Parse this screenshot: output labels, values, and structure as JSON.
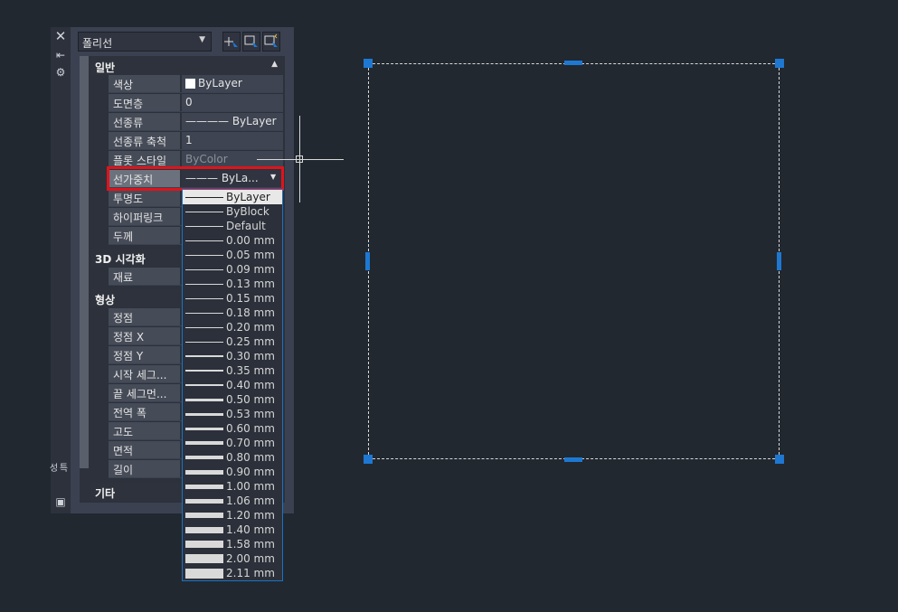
{
  "palette": {
    "object_type": "폴리선",
    "categories": {
      "general": "일반",
      "visualization3d": "3D 시각화",
      "geometry": "형상",
      "misc": "기타"
    },
    "general_rows": [
      {
        "label": "색상",
        "value": "ByLayer"
      },
      {
        "label": "도면층",
        "value": "0"
      },
      {
        "label": "선종류",
        "value": "———— ByLayer"
      },
      {
        "label": "선종류 축척",
        "value": "1"
      },
      {
        "label": "플롯 스타일",
        "value": "ByColor"
      },
      {
        "label": "선가중치",
        "value": "——— ByLa..."
      },
      {
        "label": "투명도",
        "value": ""
      },
      {
        "label": "하이퍼링크",
        "value": ""
      },
      {
        "label": "두께",
        "value": ""
      }
    ],
    "visual_rows": [
      {
        "label": "재료",
        "value": ""
      }
    ],
    "geometry_rows": [
      {
        "label": "정점",
        "value": ""
      },
      {
        "label": "정점 X",
        "value": ""
      },
      {
        "label": "정점 Y",
        "value": ""
      },
      {
        "label": "시작 세그...",
        "value": ""
      },
      {
        "label": "끝 세그먼...",
        "value": ""
      },
      {
        "label": "전역 폭",
        "value": ""
      },
      {
        "label": "고도",
        "value": ""
      },
      {
        "label": "면적",
        "value": ""
      },
      {
        "label": "길이",
        "value": ""
      }
    ],
    "side_label": "특성"
  },
  "lineweight_options": [
    "ByLayer",
    "ByBlock",
    "Default",
    "0.00 mm",
    "0.05 mm",
    "0.09 mm",
    "0.13 mm",
    "0.15 mm",
    "0.18 mm",
    "0.20 mm",
    "0.25 mm",
    "0.30 mm",
    "0.35 mm",
    "0.40 mm",
    "0.50 mm",
    "0.53 mm",
    "0.60 mm",
    "0.70 mm",
    "0.80 mm",
    "0.90 mm",
    "1.00 mm",
    "1.06 mm",
    "1.20 mm",
    "1.40 mm",
    "1.58 mm",
    "2.00 mm",
    "2.11 mm"
  ],
  "selected_option": "ByLayer",
  "colors": {
    "background": "#212830",
    "grip": "#1e78d2",
    "highlight": "#e0131b",
    "dropdown_border": "#1a73c4"
  }
}
